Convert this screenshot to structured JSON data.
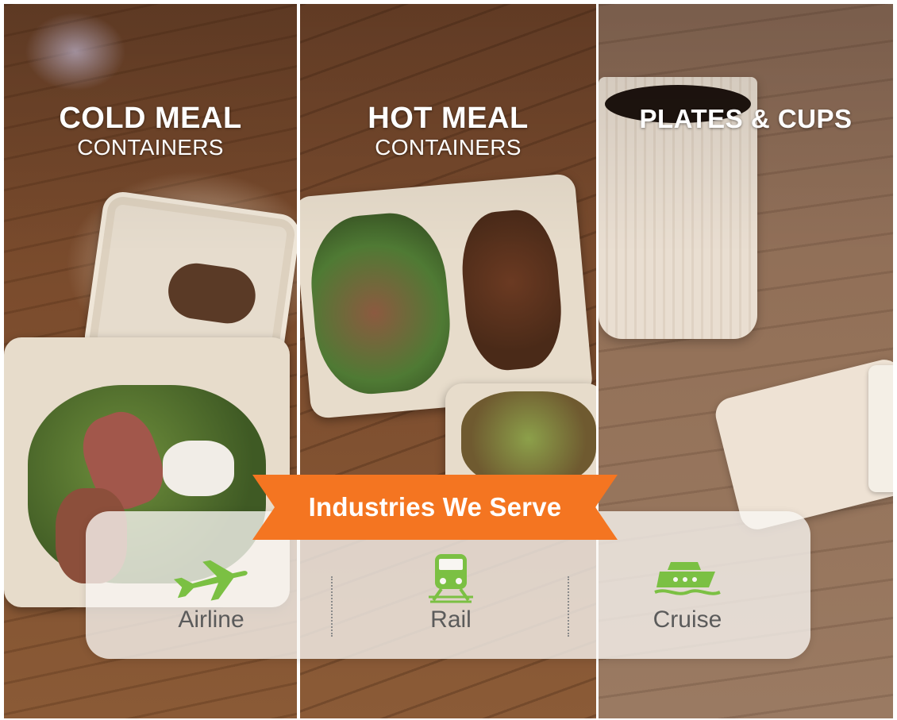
{
  "panels": [
    {
      "id": "cold",
      "title": "COLD MEAL",
      "subtitle": "CONTAINERS"
    },
    {
      "id": "hot",
      "title": "HOT MEAL",
      "subtitle": "CONTAINERS"
    },
    {
      "id": "plates",
      "title": "PLATES & CUPS",
      "subtitle": ""
    }
  ],
  "banner": {
    "label": "Industries We Serve",
    "color": "#f47521"
  },
  "industries": [
    {
      "label": "Airline",
      "icon": "airplane-icon"
    },
    {
      "label": "Rail",
      "icon": "train-icon"
    },
    {
      "label": "Cruise",
      "icon": "ship-icon"
    }
  ],
  "colors": {
    "icon_green": "#7bc043",
    "label_gray": "#5b5b5b",
    "card_bg": "#f8f6f2"
  }
}
